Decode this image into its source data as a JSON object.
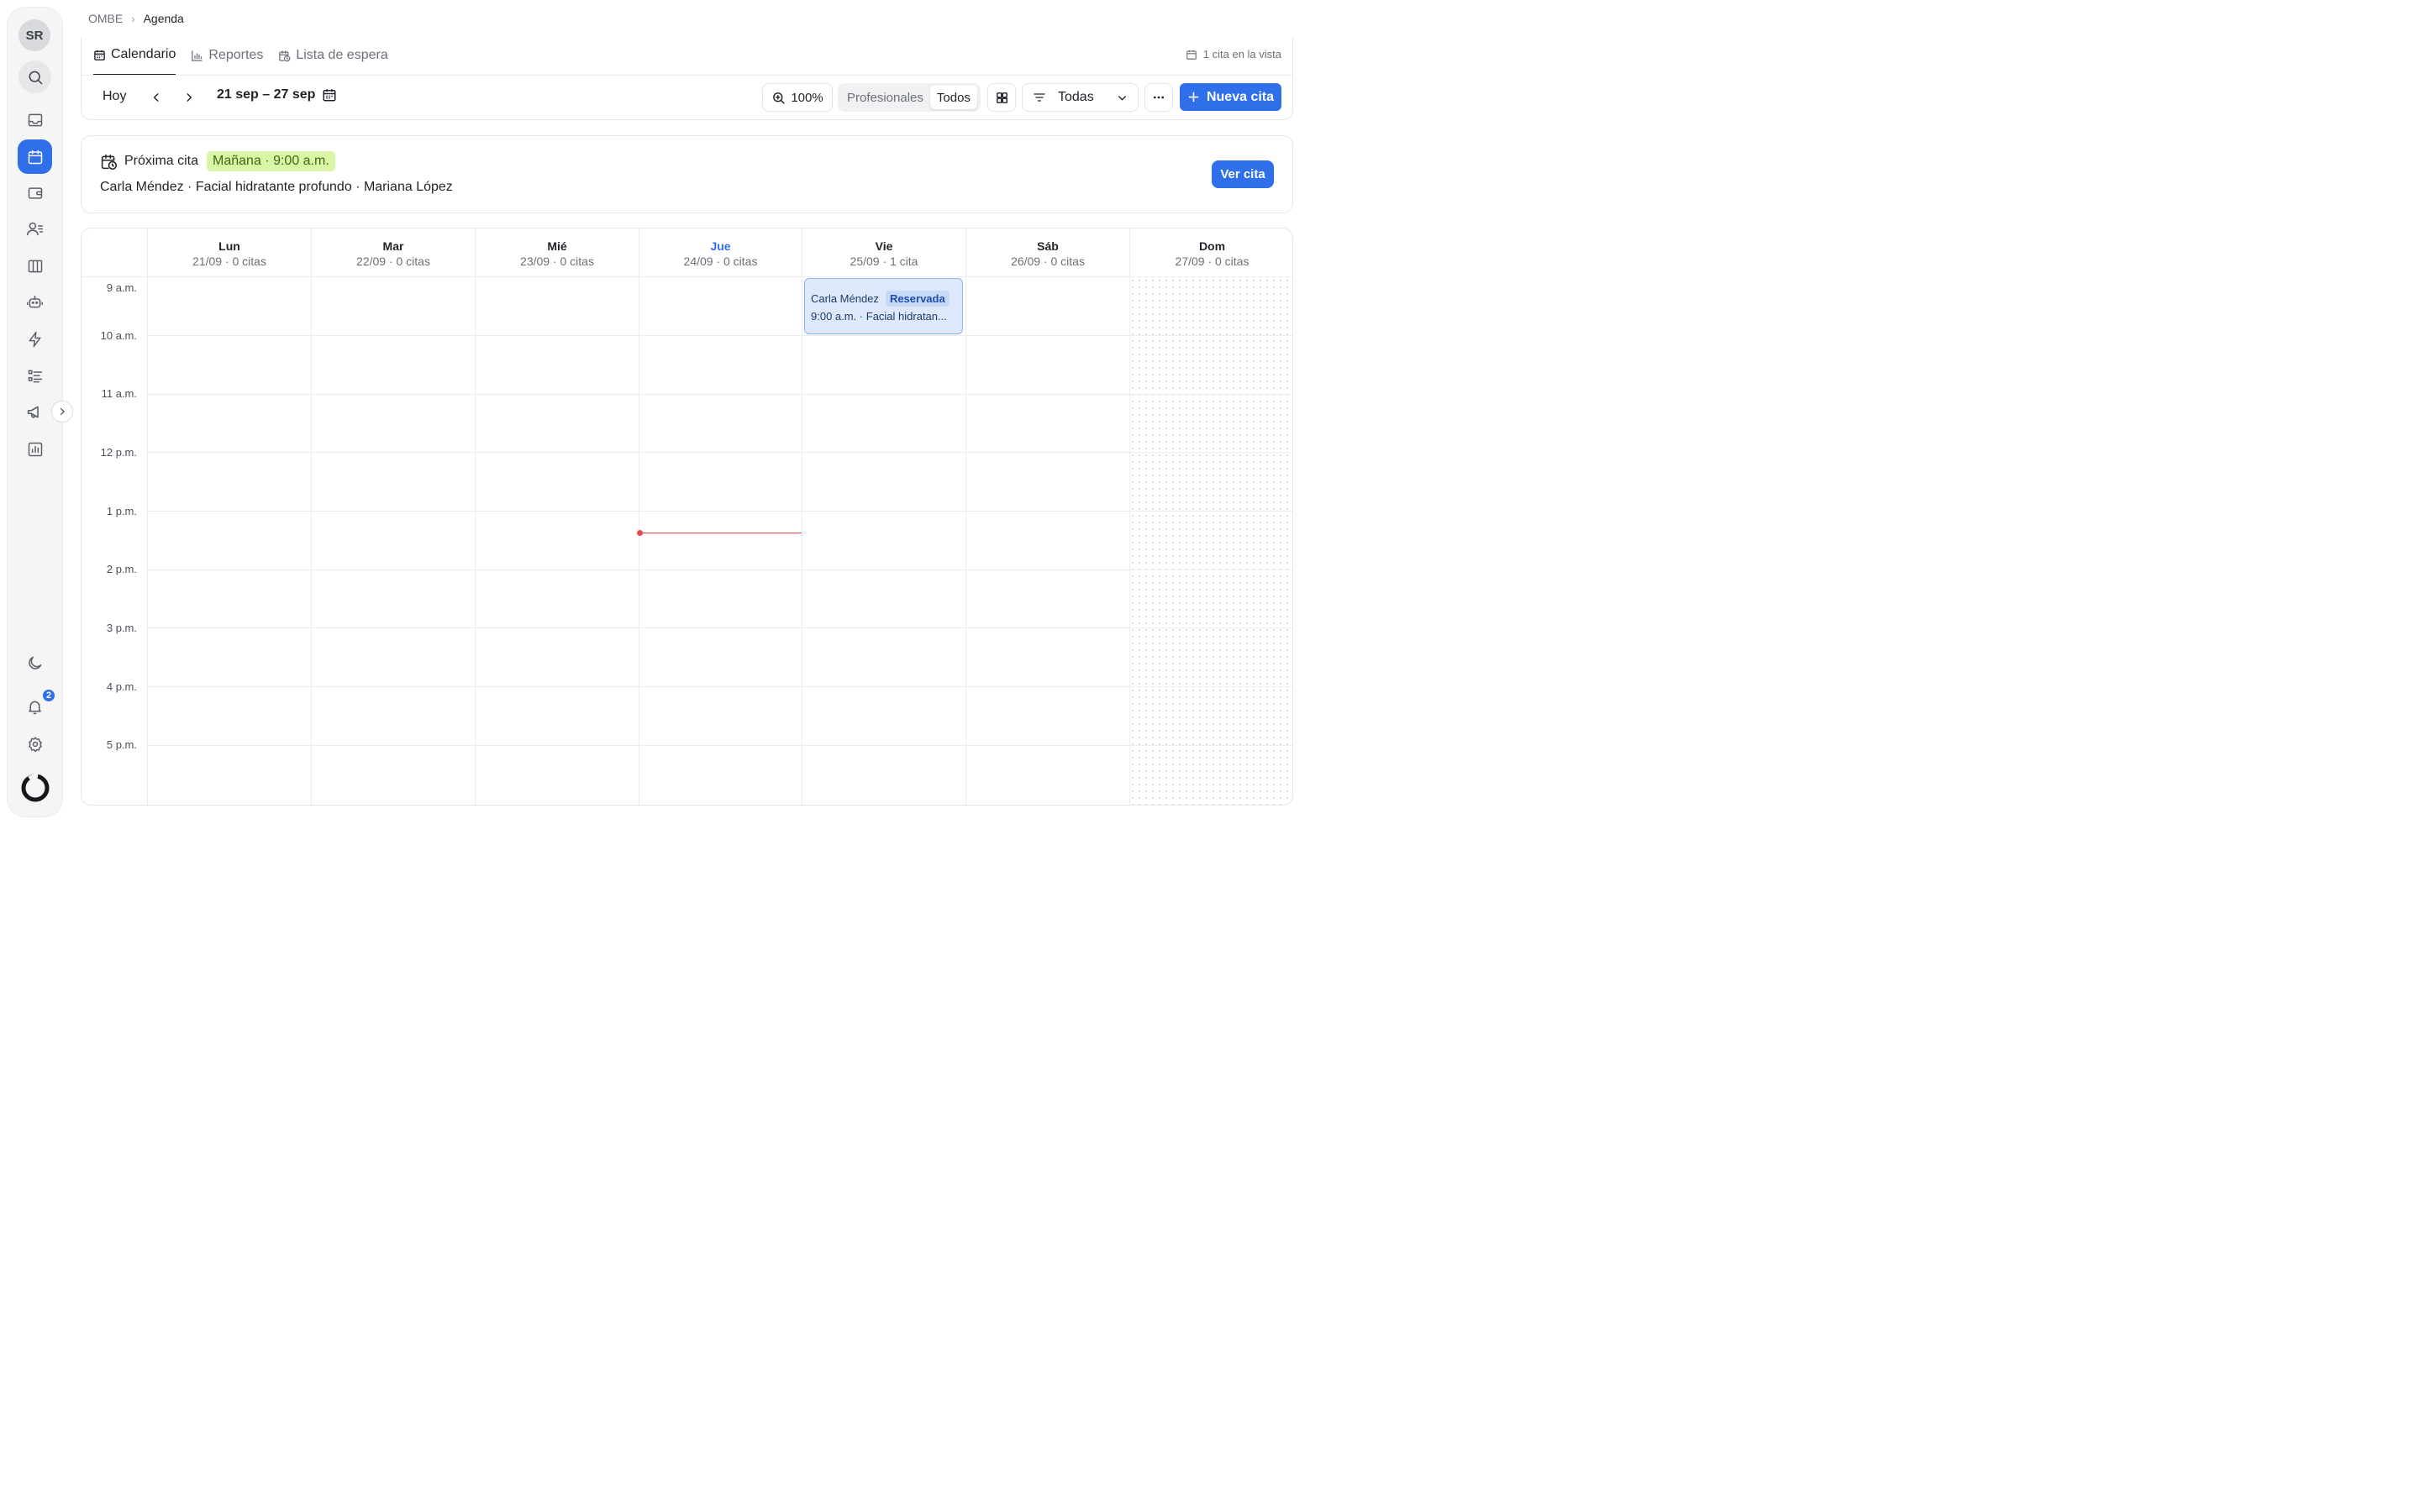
{
  "user": {
    "initials": "SR"
  },
  "notifications": {
    "count": "2"
  },
  "breadcrumb": {
    "root": "OMBE",
    "separator": "›",
    "current": "Agenda"
  },
  "tabs": [
    {
      "label": "Calendario",
      "icon": "calendar-icon",
      "active": true
    },
    {
      "label": "Reportes",
      "icon": "bar-chart-icon",
      "active": false
    },
    {
      "label": "Lista de espera",
      "icon": "calendar-clock-icon",
      "active": false
    }
  ],
  "view_count": "1 cita en la vista",
  "toolbar": {
    "today": "Hoy",
    "range": "21 sep – 27 sep",
    "zoom": "100%",
    "segment": {
      "options": [
        "Profesionales",
        "Todos"
      ],
      "selected": "Todos"
    },
    "filter_value": "Todas",
    "new_label": "Nueva cita"
  },
  "next_appointment": {
    "title": "Próxima cita",
    "when": "Mañana · 9:00 a.m.",
    "detail": "Carla Méndez · Facial hidratante profundo · Mariana López",
    "button": "Ver cita"
  },
  "calendar": {
    "days": [
      {
        "name": "Lun",
        "sub": "21/09 · 0 citas",
        "today": false
      },
      {
        "name": "Mar",
        "sub": "22/09 · 0 citas",
        "today": false
      },
      {
        "name": "Mié",
        "sub": "23/09 · 0 citas",
        "today": false
      },
      {
        "name": "Jue",
        "sub": "24/09 · 0 citas",
        "today": true
      },
      {
        "name": "Vie",
        "sub": "25/09 · 1 cita",
        "today": false
      },
      {
        "name": "Sáb",
        "sub": "26/09 · 0 citas",
        "today": false
      },
      {
        "name": "Dom",
        "sub": "27/09 · 0 citas",
        "today": false,
        "closed": true
      }
    ],
    "hours": [
      "9 a.m.",
      "10 a.m.",
      "11 a.m.",
      "12 p.m.",
      "1 p.m.",
      "2 p.m.",
      "3 p.m.",
      "4 p.m.",
      "5 p.m."
    ],
    "events": [
      {
        "day": "Vie",
        "client": "Carla Méndez",
        "status": "Reservada",
        "time_service": "9:00 a.m. · Facial hidratan...",
        "color": "#dde9fb"
      }
    ],
    "now_indicator_color": "#e5484d"
  },
  "colors": {
    "accent": "#2f6fe9",
    "today": "#2f6fe9",
    "badge_green": "#d8f5a8"
  }
}
